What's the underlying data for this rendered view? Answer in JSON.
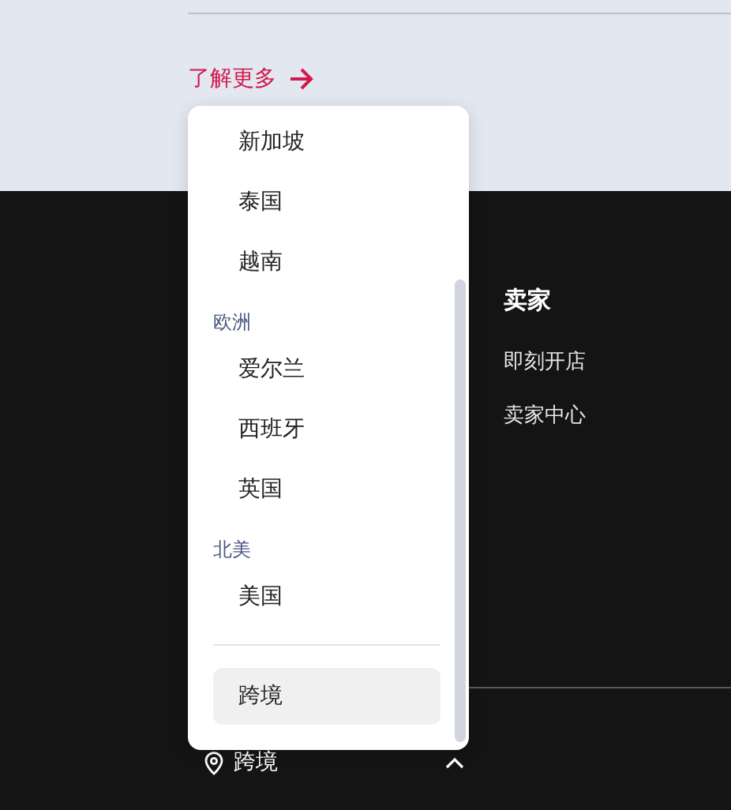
{
  "learn_more": {
    "label": "了解更多"
  },
  "region_menu": {
    "groups": [
      {
        "items": [
          {
            "label": "新加坡",
            "selected": false
          },
          {
            "label": "泰国",
            "selected": false
          },
          {
            "label": "越南",
            "selected": false
          }
        ]
      },
      {
        "title": "欧洲",
        "items": [
          {
            "label": "爱尔兰",
            "selected": false
          },
          {
            "label": "西班牙",
            "selected": false
          },
          {
            "label": "英国",
            "selected": false
          }
        ]
      },
      {
        "title": "北美",
        "items": [
          {
            "label": "美国",
            "selected": false
          }
        ]
      }
    ],
    "footer_item": {
      "label": "跨境",
      "selected": true
    }
  },
  "seller_column": {
    "title": "卖家",
    "links": [
      "即刻开店",
      "卖家中心"
    ]
  },
  "region_selector": {
    "label": "跨境",
    "expanded": true
  }
}
